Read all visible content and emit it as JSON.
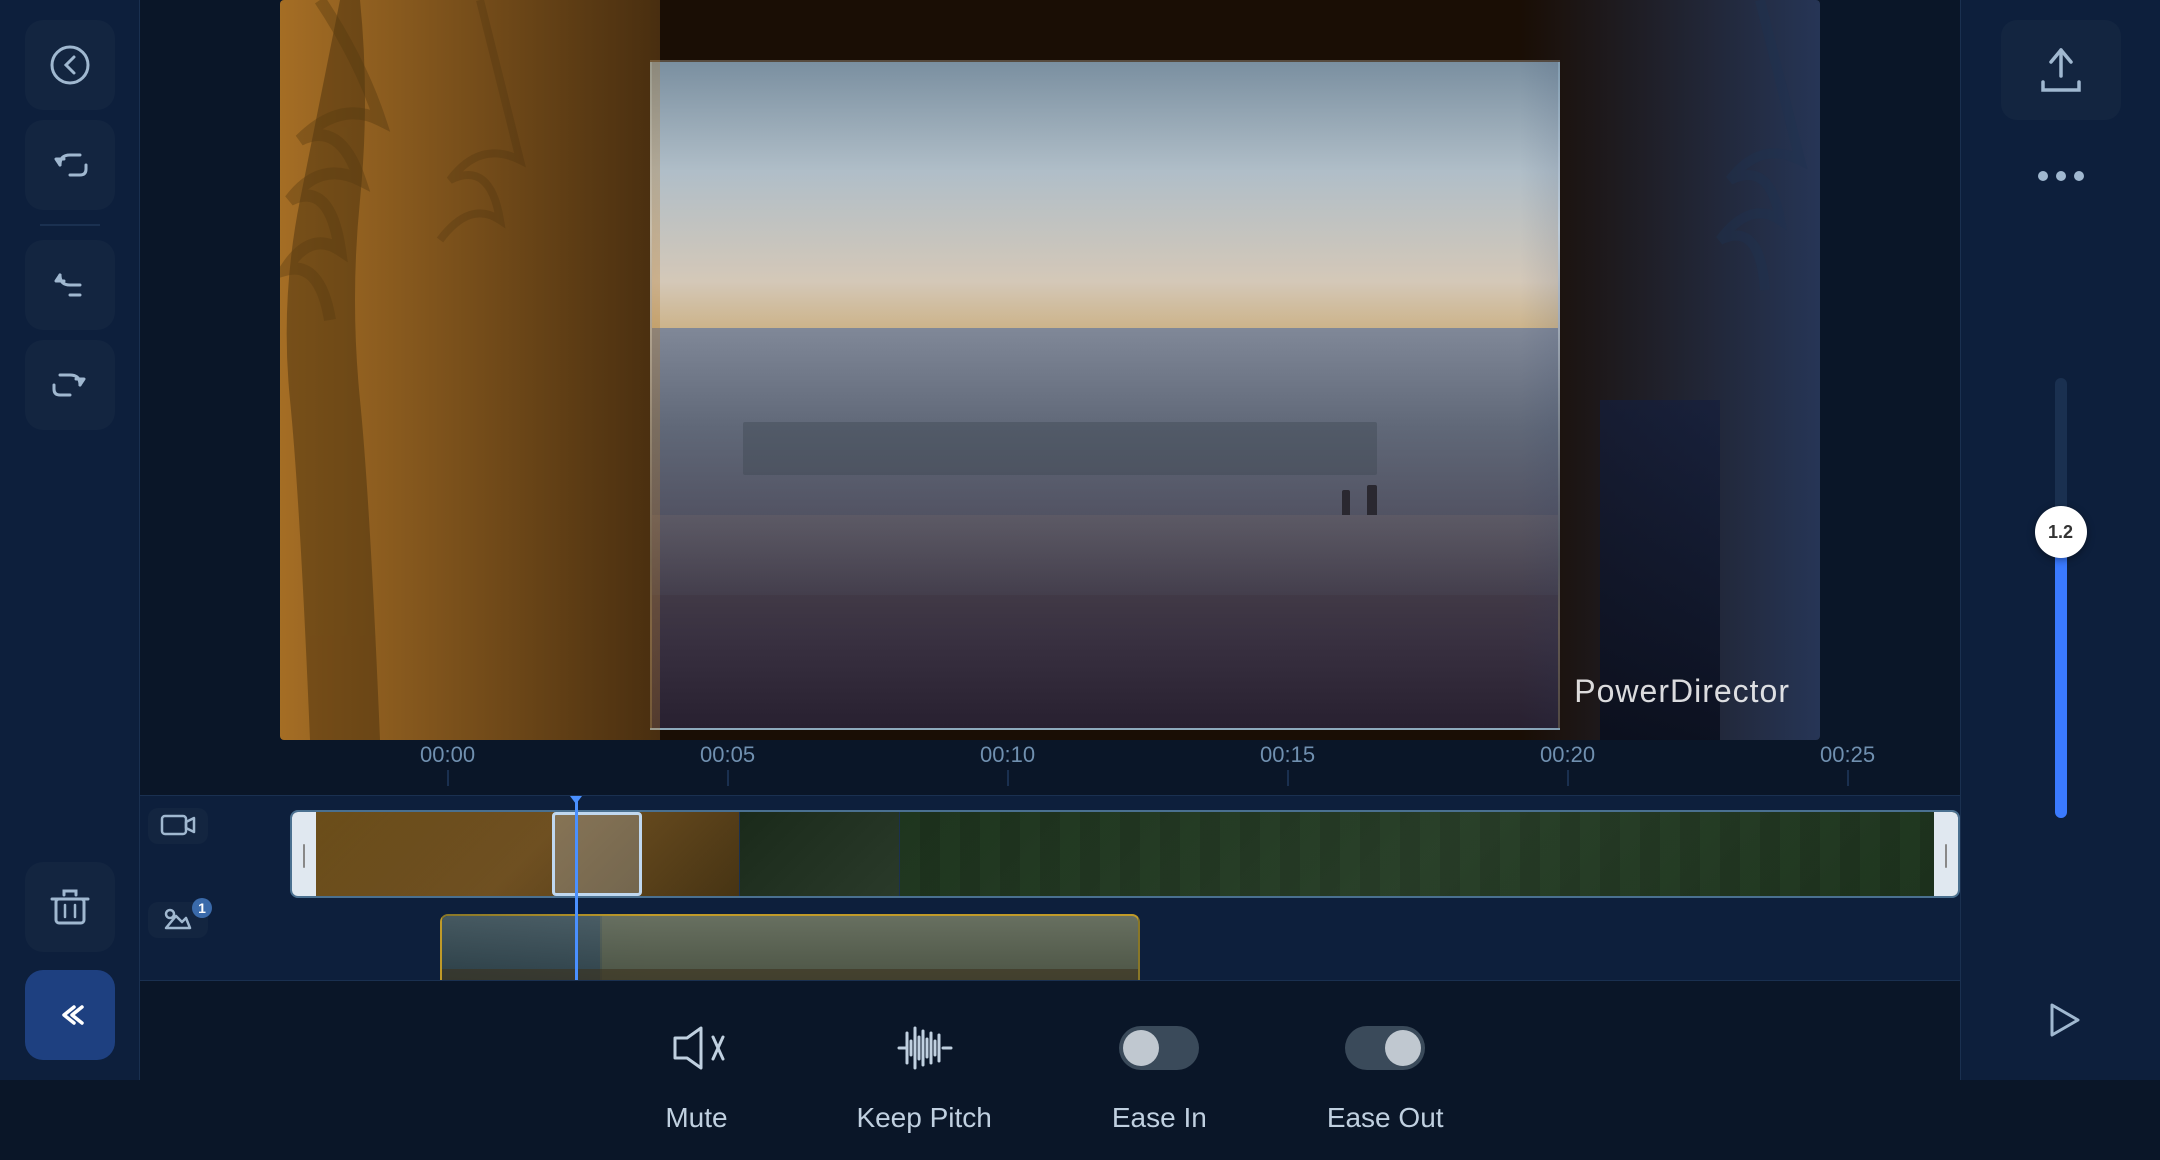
{
  "app": {
    "title": "PowerDirector",
    "watermark": "PowerDirector"
  },
  "sidebar": {
    "back_label": "back",
    "undo_label": "undo",
    "redo_label": "redo",
    "delete_label": "delete",
    "collapse_label": "collapse"
  },
  "timeline": {
    "ruler_marks": [
      "00:00",
      "00:05",
      "00:10",
      "00:15",
      "00:20",
      "00:25"
    ]
  },
  "right_panel": {
    "volume_value": "1.2",
    "export_label": "export",
    "more_label": "more options",
    "play_label": "play"
  },
  "toolbar": {
    "mute_label": "Mute",
    "keep_pitch_label": "Keep Pitch",
    "ease_in_label": "Ease In",
    "ease_out_label": "Ease Out"
  }
}
